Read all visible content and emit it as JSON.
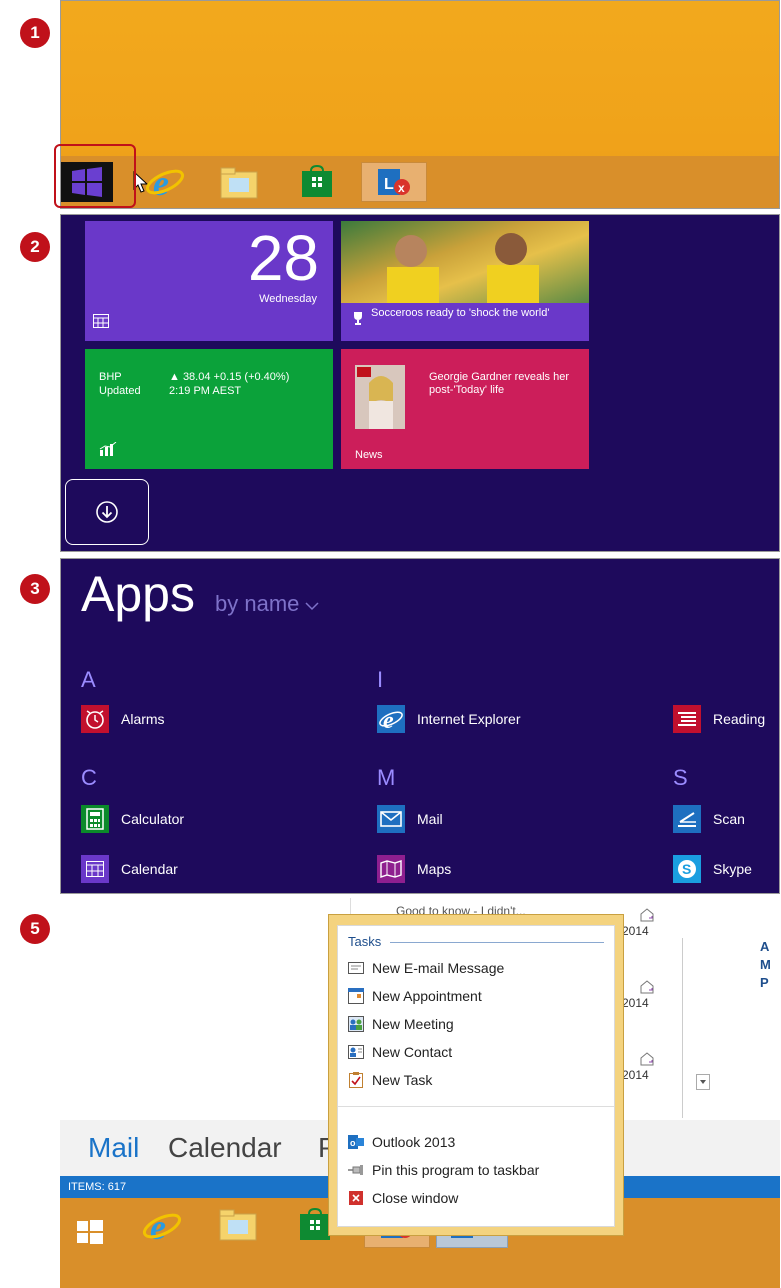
{
  "steps": {
    "s1": "1",
    "s2": "2",
    "s3": "3",
    "s5": "5"
  },
  "panel2": {
    "calendar_day": "28",
    "calendar_weekday": "Wednesday",
    "sport_headline": "Socceroos ready to 'shock the world'",
    "finance_ticker": "BHP",
    "finance_updated": "Updated",
    "finance_change": "▲ 38.04  +0.15 (+0.40%)",
    "finance_time": "2:19 PM AEST",
    "news_headline": "Georgie Gardner reveals her post-'Today' life",
    "news_label": "News"
  },
  "panel3": {
    "title": "Apps",
    "sort": "by name",
    "groups": [
      {
        "letter": "A",
        "apps": [
          "Alarms"
        ]
      },
      {
        "letter": "C",
        "apps": [
          "Calculator",
          "Calendar"
        ]
      },
      {
        "letter": "I",
        "apps": [
          "Internet Explorer"
        ]
      },
      {
        "letter": "M",
        "apps": [
          "Mail",
          "Maps"
        ]
      },
      {
        "letter": "S",
        "apps": [
          "Scan",
          "Skype"
        ]
      }
    ],
    "extra_app": "Reading"
  },
  "panel5": {
    "jumplist": {
      "section": "Tasks",
      "tasks": [
        "New E-mail Message",
        "New Appointment",
        "New Meeting",
        "New Contact",
        "New Task"
      ],
      "app_name": "Outlook 2013",
      "pin": "Pin this program to taskbar",
      "close": "Close window"
    },
    "bg_text": "Good to know - I didn't...",
    "year_labels": [
      "2014",
      "2014",
      "2014"
    ],
    "right_letters": [
      "A",
      "M",
      "P"
    ],
    "bottom_tabs": [
      "Mail",
      "Calendar",
      "P"
    ],
    "status": "ITEMS: 617"
  },
  "colors": {
    "accent_red": "#c0111a",
    "start_bg": "#1e0a5c",
    "taskbar": "#d98f2a"
  }
}
